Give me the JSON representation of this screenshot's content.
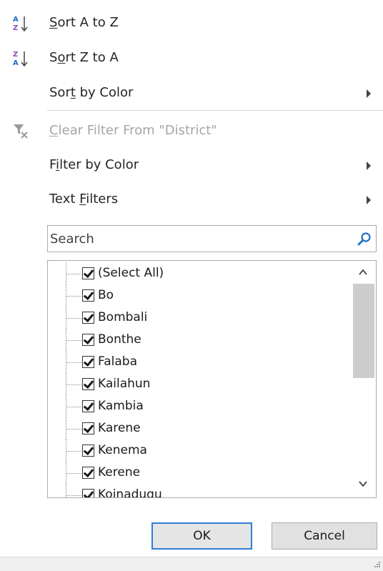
{
  "menu": {
    "sort_az": {
      "pre": "",
      "key": "S",
      "post": "ort A to Z"
    },
    "sort_za": {
      "pre": "S",
      "key": "o",
      "post": "rt Z to A"
    },
    "sort_color": {
      "pre": "Sor",
      "key": "t",
      "post": " by Color"
    },
    "clear_filter": {
      "pre": "",
      "key": "C",
      "post": "lear Filter From \"District\""
    },
    "filter_color": {
      "pre": "F",
      "key": "i",
      "post": "lter by Color"
    },
    "text_filters": {
      "pre": "Text ",
      "key": "F",
      "post": "ilters"
    }
  },
  "search": {
    "placeholder": "Search",
    "value": ""
  },
  "items": [
    {
      "label": "(Select All)",
      "checked": true
    },
    {
      "label": "Bo",
      "checked": true
    },
    {
      "label": "Bombali",
      "checked": true
    },
    {
      "label": "Bonthe",
      "checked": true
    },
    {
      "label": "Falaba",
      "checked": true
    },
    {
      "label": "Kailahun",
      "checked": true
    },
    {
      "label": "Kambia",
      "checked": true
    },
    {
      "label": "Karene",
      "checked": true
    },
    {
      "label": "Kenema",
      "checked": true
    },
    {
      "label": "Kerene",
      "checked": true
    },
    {
      "label": "Koinadugu",
      "checked": true
    }
  ],
  "buttons": {
    "ok": "OK",
    "cancel": "Cancel"
  },
  "colors": {
    "accent": "#2f7fd6",
    "sort_icon_blue": "#1e6fc9",
    "sort_icon_purple": "#8a4fb5",
    "disabled_text": "#a6a6a6"
  }
}
